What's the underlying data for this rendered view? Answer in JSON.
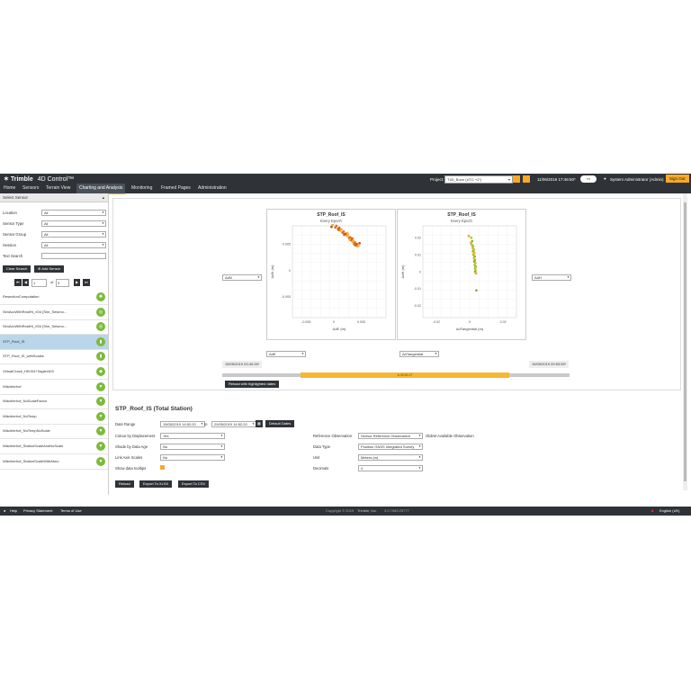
{
  "header": {
    "brand": "Trimble",
    "product": "4D Control™",
    "project_label": "Project:",
    "project_value": "T4D_Bonn (UTC +2°)",
    "datetime": "11/06/2019 17:46:50*",
    "toggle_label": "m",
    "user": "System Administrator (Admin)",
    "signout": "Sign Out",
    "nav": [
      "Home",
      "Sensors",
      "Terrain View",
      "Charting and Analysis",
      "Monitoring",
      "Framed Pages",
      "Administration"
    ]
  },
  "sidebar": {
    "title": "Select Sensor",
    "filters": [
      {
        "label": "Location",
        "value": "All"
      },
      {
        "label": "Sensor Type",
        "value": "All"
      },
      {
        "label": "Sensor Group",
        "value": "All"
      },
      {
        "label": "Session",
        "value": "All"
      },
      {
        "label": "Text Search",
        "value": ""
      }
    ],
    "clear_search": "Clear Search",
    "add_sensor": "Add Sensor",
    "page_current": "1",
    "page_of": "of",
    "page_total": "3",
    "sensors": [
      {
        "name": "ResectionComputation",
        "icon": "satellite-icon"
      },
      {
        "name": "SimAccWithRealHt_X04 [Sim_Seismo...",
        "icon": "sensor-icon"
      },
      {
        "name": "SimAccWithRealHt_X04 [Sim_Seismo...",
        "icon": "sensor-icon"
      },
      {
        "name": "STP_Roof_IS",
        "icon": "station-icon"
      },
      {
        "name": "STP_Roof_IS_withScales",
        "icon": "station-icon"
      },
      {
        "name": "VirtualCrack_HK004+Sagler403",
        "icon": "crack-icon"
      },
      {
        "name": "Wächterhof",
        "icon": "gnss-icon"
      },
      {
        "name": "Wächterhof_NoScaleFactor",
        "icon": "gnss-icon"
      },
      {
        "name": "Wächterhof_NoTemp",
        "icon": "gnss-icon"
      },
      {
        "name": "Wächterhof_NoTempNoScale",
        "icon": "gnss-icon"
      },
      {
        "name": "Wächterhof_StationScaleAndNoScale",
        "icon": "gnss-icon"
      },
      {
        "name": "Wächterhof_StationScaleWithAtmo",
        "icon": "gnss-icon"
      }
    ]
  },
  "charts": {
    "left_axis_select": "ΔdN",
    "right_axis_select": "ΔdH",
    "left_x_select": "ΔdE",
    "right_x_select": "ΔdTangential",
    "start_time": "15/05/2019 03:40:26*",
    "end_time": "15/05/2019 09:53:55*",
    "center_time": "Δ 05:53:27",
    "reload_button": "Reload with highlighted dates",
    "panels": [
      {
        "title": "STP_Roof_IS",
        "subtitle": "Every Epoch",
        "xlabel": "ΔdE (m)",
        "ylabel": "ΔdN (m)",
        "xticks": [
          "-0.005",
          "0",
          "0.005"
        ],
        "yticks": [
          "0.005",
          "0",
          "-0.005"
        ]
      },
      {
        "title": "STP_Roof_IS",
        "subtitle": "Every Epoch",
        "xlabel": "ΔdTangential (m)",
        "ylabel": "ΔdH (m)",
        "xticks": [
          "-0.02",
          "0",
          "0.02"
        ],
        "yticks": [
          "0.02",
          "0.01",
          "0",
          "-0.01",
          "-0.02"
        ]
      }
    ]
  },
  "chart_data": [
    {
      "type": "scatter",
      "title": "STP_Roof_IS",
      "subtitle": "Every Epoch",
      "xlabel": "ΔdE (m)",
      "ylabel": "ΔdN (m)",
      "xlim": [
        -0.0075,
        0.0095
      ],
      "ylim": [
        -0.009,
        0.0085
      ],
      "grid": true,
      "colors": [
        "#f7a928",
        "#e07020",
        "#c85a10"
      ],
      "points": [
        [
          -0.0002,
          0.0087
        ],
        [
          0.0003,
          0.0082
        ],
        [
          0.0008,
          0.0079
        ],
        [
          0.0012,
          0.0076
        ],
        [
          0.0016,
          0.0072
        ],
        [
          0.002,
          0.0069
        ],
        [
          0.0024,
          0.0066
        ],
        [
          0.0028,
          0.0062
        ],
        [
          0.0031,
          0.0058
        ],
        [
          0.0034,
          0.0055
        ],
        [
          0.0037,
          0.0051
        ],
        [
          0.004,
          0.0048
        ],
        [
          0.0043,
          0.0046
        ],
        [
          0.0005,
          0.0085
        ],
        [
          0.001,
          0.0081
        ],
        [
          0.0014,
          0.0078
        ],
        [
          0.0018,
          0.0074
        ],
        [
          0.0022,
          0.007
        ],
        [
          0.0026,
          0.0067
        ],
        [
          0.003,
          0.0063
        ],
        [
          0.0033,
          0.006
        ],
        [
          0.0036,
          0.0056
        ],
        [
          0.0039,
          0.0053
        ],
        [
          0.0042,
          0.005
        ],
        [
          0.0045,
          0.0047
        ],
        [
          0.0009,
          0.0077
        ],
        [
          0.0019,
          0.0068
        ],
        [
          0.0029,
          0.0059
        ],
        [
          0.0038,
          0.0049
        ],
        [
          0.0047,
          0.0052
        ],
        [
          0.0025,
          0.0071
        ],
        [
          0.0034,
          0.0061
        ],
        [
          -0.0004,
          0.0083
        ]
      ]
    },
    {
      "type": "scatter",
      "title": "STP_Roof_IS",
      "subtitle": "Every Epoch",
      "xlabel": "ΔdTangential (m)",
      "ylabel": "ΔdH (m)",
      "xlim": [
        -0.028,
        0.028
      ],
      "ylim": [
        -0.027,
        0.027
      ],
      "grid": true,
      "colors": [
        "#f7a928",
        "#a6cc3a",
        "#7cba3b"
      ],
      "points": [
        [
          -0.0005,
          0.021
        ],
        [
          0.001,
          0.02
        ],
        [
          0.0015,
          0.018
        ],
        [
          0.0008,
          0.017
        ],
        [
          0.0012,
          0.016
        ],
        [
          0.002,
          0.015
        ],
        [
          0.0018,
          0.014
        ],
        [
          0.0025,
          0.013
        ],
        [
          0.002,
          0.012
        ],
        [
          0.0028,
          0.011
        ],
        [
          0.0022,
          0.01
        ],
        [
          0.003,
          0.009
        ],
        [
          0.0026,
          0.008
        ],
        [
          0.0032,
          0.007
        ],
        [
          0.0028,
          0.006
        ],
        [
          0.0034,
          0.005
        ],
        [
          0.003,
          0.004
        ],
        [
          0.0036,
          0.003
        ],
        [
          0.0032,
          0.002
        ],
        [
          0.0035,
          0.001
        ],
        [
          0.0033,
          0.0
        ],
        [
          0.0038,
          -0.001
        ],
        [
          0.0034,
          0.0025
        ],
        [
          0.0029,
          0.0065
        ],
        [
          0.0024,
          0.0115
        ],
        [
          0.0016,
          0.0155
        ],
        [
          0.004,
          -0.011
        ]
      ]
    }
  ],
  "details": {
    "title": "STP_Roof_IS (Total Station)",
    "date_range_label": "Date Range",
    "date_from": "15/05/2019 14:52:20",
    "date_to_label": "to",
    "date_to": "20/05/2019 14:52:20",
    "default_dates": "Default Dates",
    "left_fields": [
      {
        "label": "Colour by Displacement",
        "value": "Yes"
      },
      {
        "label": "Shade by Data Age",
        "value": "No"
      },
      {
        "label": "Link Axis Scales",
        "value": "No"
      }
    ],
    "show_tooltips_label": "Show data tooltips",
    "right_fields": [
      {
        "label": "Reference Observation",
        "value": "Sensor Reference Observation",
        "extra": "Oldest Available Observation"
      },
      {
        "label": "Data Type",
        "value": "Position GNSS Integrated Survey",
        "extra": ""
      },
      {
        "label": "Unit",
        "value": "Meters (m)",
        "extra": ""
      },
      {
        "label": "Decimals",
        "value": "4",
        "extra": ""
      }
    ],
    "reload": "Reload",
    "export_xlsx": "Export To XLSX",
    "export_csv": "Export To CSV"
  },
  "footer": {
    "help": "Help",
    "privacy": "Privacy Statement",
    "terms": "Terms of Use",
    "copyright": "Copyright © 2019",
    "company": "Trimble, Inc.",
    "version": "3.0.7089.25777",
    "language": "English (UK)"
  }
}
